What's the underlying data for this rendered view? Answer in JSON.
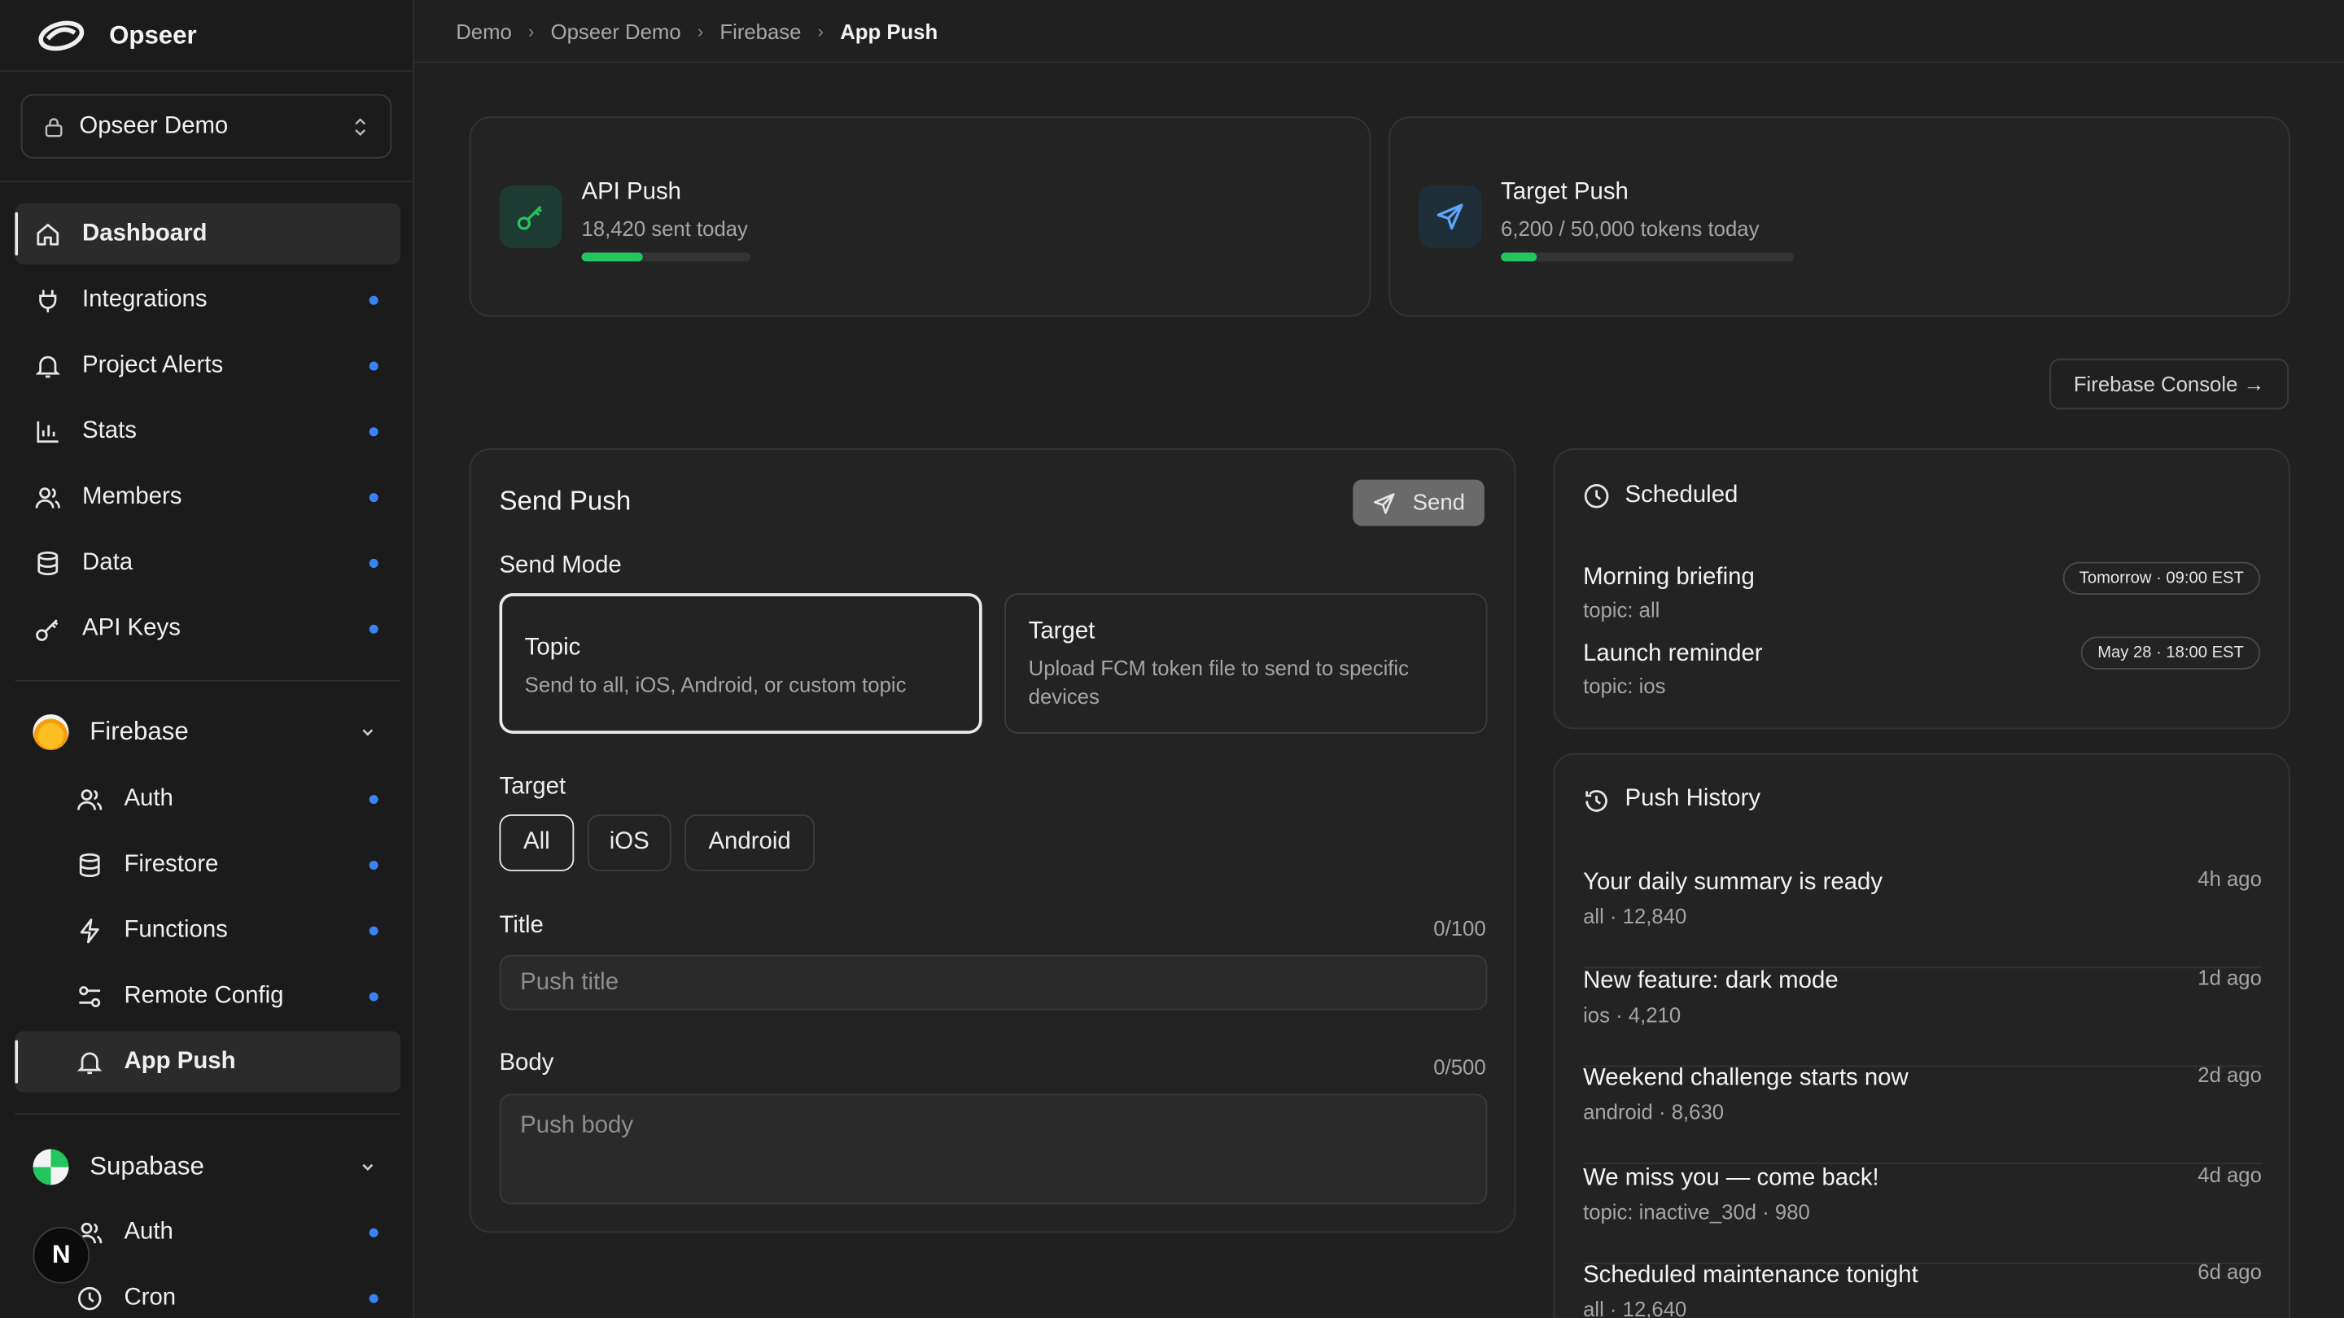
{
  "brand": {
    "name": "Opseer"
  },
  "project": {
    "name": "Opseer Demo"
  },
  "nav": {
    "items": [
      {
        "label": "Dashboard"
      },
      {
        "label": "Integrations"
      },
      {
        "label": "Project Alerts"
      },
      {
        "label": "Stats"
      },
      {
        "label": "Members"
      },
      {
        "label": "Data"
      },
      {
        "label": "API Keys"
      }
    ],
    "firebase": {
      "label": "Firebase",
      "items": [
        {
          "label": "Auth"
        },
        {
          "label": "Firestore"
        },
        {
          "label": "Functions"
        },
        {
          "label": "Remote Config"
        },
        {
          "label": "App Push"
        }
      ]
    },
    "supabase": {
      "label": "Supabase",
      "items": [
        {
          "label": "Auth"
        },
        {
          "label": "Cron"
        }
      ]
    },
    "avatar_letter": "N"
  },
  "breadcrumb": [
    "Demo",
    "Opseer Demo",
    "Firebase",
    "App Push"
  ],
  "stats": {
    "api_push": {
      "title": "API Push",
      "sub": "18,420 sent today",
      "progress": 0.36
    },
    "target_push": {
      "title": "Target Push",
      "sub": "6,200 / 50,000 tokens today",
      "progress": 0.124
    }
  },
  "console_button": "Firebase Console →",
  "send": {
    "title": "Send Push",
    "send_label": "Send",
    "mode_label": "Send Mode",
    "modes": [
      {
        "title": "Topic",
        "desc": "Send to all, iOS, Android, or custom topic"
      },
      {
        "title": "Target",
        "desc": "Upload FCM token file to send to specific devices"
      }
    ],
    "target_label": "Target",
    "targets": [
      "All",
      "iOS",
      "Android"
    ],
    "title_label": "Title",
    "title_counter": "0/100",
    "title_placeholder": "Push title",
    "body_label": "Body",
    "body_counter": "0/500",
    "body_placeholder": "Push body"
  },
  "scheduled": {
    "title": "Scheduled",
    "items": [
      {
        "title": "Morning briefing",
        "sub": "topic: all",
        "when": "Tomorrow · 09:00 EST"
      },
      {
        "title": "Launch reminder",
        "sub": "topic: ios",
        "when": "May 28 · 18:00 EST"
      }
    ]
  },
  "history": {
    "title": "Push History",
    "items": [
      {
        "title": "Your daily summary is ready",
        "sub": "all · 12,840",
        "ago": "4h ago"
      },
      {
        "title": "New feature: dark mode",
        "sub": "ios · 4,210",
        "ago": "1d ago"
      },
      {
        "title": "Weekend challenge starts now",
        "sub": "android · 8,630",
        "ago": "2d ago"
      },
      {
        "title": "We miss you — come back!",
        "sub": "topic: inactive_30d · 980",
        "ago": "4d ago"
      },
      {
        "title": "Scheduled maintenance tonight",
        "sub": "all · 12,640",
        "ago": "6d ago"
      }
    ]
  },
  "colors": {
    "accent": "#22c55e",
    "dot": "#3b82f6",
    "background": "#202020",
    "sidebar": "#1b1b1b"
  }
}
